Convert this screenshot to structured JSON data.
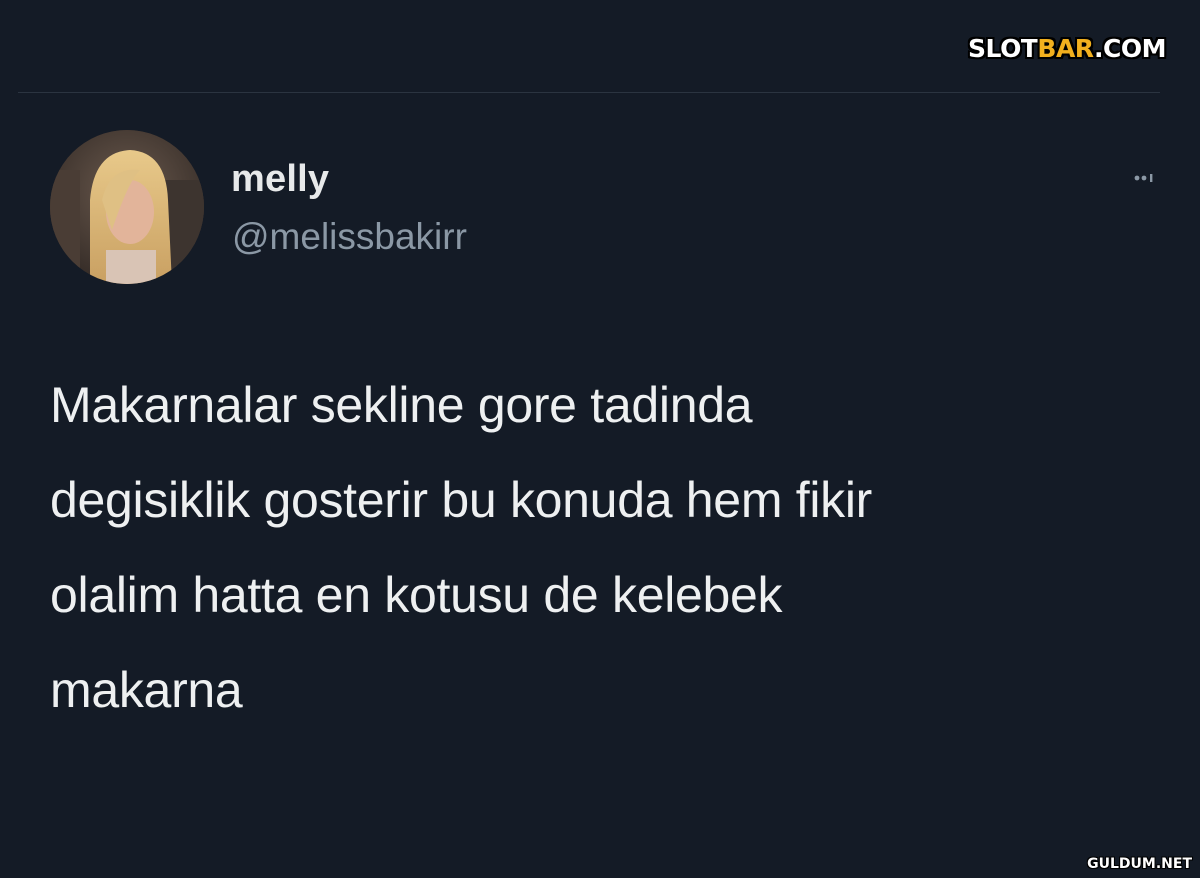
{
  "watermark_top": {
    "part1": "SLOT",
    "part2": "BAR",
    "part3": ".COM",
    "accent_color": "#f2b01e"
  },
  "tweet": {
    "display_name": "melly",
    "handle": "@melissbakirr",
    "text": "Makarnalar sekline gore tadinda\ndegisiklik gosterir bu konuda hem fikir\nolalim hatta en kotusu de kelebek\nmakarna",
    "more_icon": "more-options-icon",
    "avatar_icon": "profile-photo"
  },
  "watermark_bottom": {
    "text": "GULDUM.NET"
  },
  "colors": {
    "background": "#141b26",
    "text_primary": "#e7e9ea",
    "text_secondary": "#8b98a5"
  }
}
